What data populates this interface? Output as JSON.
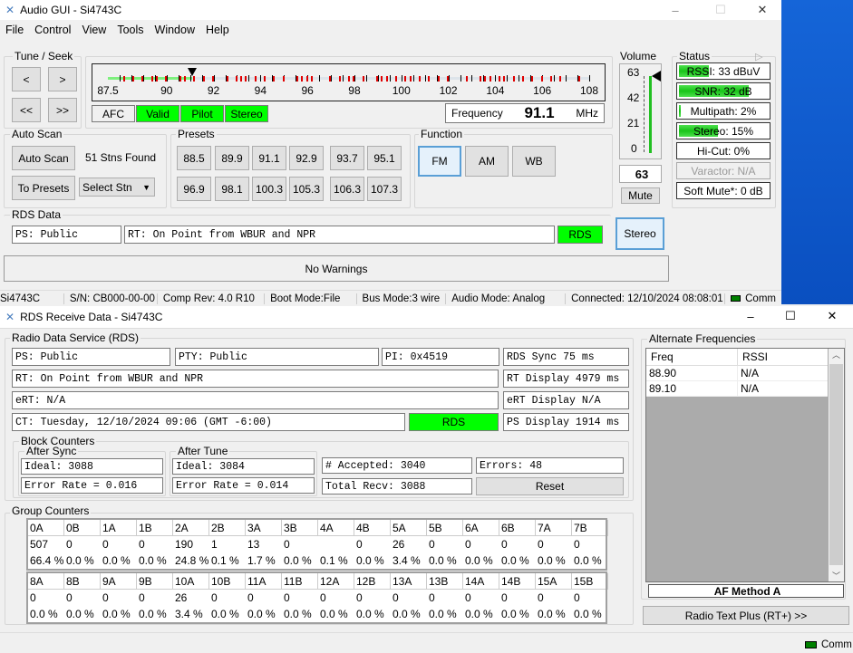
{
  "main_window": {
    "title": "Audio GUI - Si4743C",
    "menu": [
      "File",
      "Control",
      "View",
      "Tools",
      "Window",
      "Help"
    ],
    "tune_seek": {
      "label": "Tune / Seek",
      "buttons": [
        "<",
        ">",
        "<<",
        ">>"
      ]
    },
    "scale": {
      "ticks": [
        "87.5",
        "90",
        "92",
        "94",
        "96",
        "98",
        "100",
        "102",
        "104",
        "106",
        "108"
      ],
      "min": 87.5,
      "max": 108,
      "current": 91.1
    },
    "indicators": [
      {
        "label": "AFC",
        "on": false
      },
      {
        "label": "Valid",
        "on": true
      },
      {
        "label": "Pilot",
        "on": true
      },
      {
        "label": "Stereo",
        "on": true
      }
    ],
    "frequency": {
      "label": "Frequency",
      "value": "91.1",
      "unit": "MHz"
    },
    "auto_scan": {
      "label": "Auto Scan",
      "button": "Auto Scan",
      "found": "51 Stns Found",
      "to_presets": "To Presets",
      "select": "Select Stn"
    },
    "presets": {
      "label": "Presets",
      "values": [
        "88.5",
        "89.9",
        "91.1",
        "92.9",
        "93.7",
        "95.1",
        "96.9",
        "98.1",
        "100.3",
        "105.3",
        "106.3",
        "107.3"
      ]
    },
    "function": {
      "label": "Function",
      "options": [
        "FM",
        "AM",
        "WB"
      ],
      "selected": "FM"
    },
    "volume": {
      "label": "Volume",
      "ticks": [
        "63",
        "42",
        "21",
        "0"
      ],
      "value": "63",
      "max": 63,
      "mute": "Mute"
    },
    "status": {
      "label": "Status",
      "items": [
        {
          "text": "RSSI: 33 dBuV",
          "level": 0.33
        },
        {
          "text": "SNR: 32 dB",
          "level": 0.77
        },
        {
          "text": "Multipath: 2%",
          "level": 0.02
        },
        {
          "text": "Stereo: 15%",
          "level": 0.43
        },
        {
          "text": "Hi-Cut: 0%",
          "level": 0
        },
        {
          "text": "Varactor: N/A",
          "level": 0,
          "disabled": true
        },
        {
          "text": "Soft Mute*: 0 dB",
          "level": 0
        }
      ]
    },
    "rds": {
      "label": "RDS Data",
      "ps": "PS:  Public",
      "rt": "RT: On Point from WBUR and NPR",
      "rds_button": "RDS",
      "stereo_button": "Stereo"
    },
    "warnings": "No Warnings",
    "statusbar": [
      "Si4743C",
      "S/N: CB000-00-00",
      "Comp Rev: 4.0 R10",
      "Boot Mode:File",
      "Bus Mode:3 wire",
      "Audio Mode: Analog",
      "Connected: 12/10/2024 08:08:01",
      "Comm"
    ],
    "colors": {
      "on": "#00ff00",
      "comm": "#008000"
    }
  },
  "rds_window": {
    "title": "RDS Receive Data - Si4743C",
    "rds_group": "Radio Data Service (RDS)",
    "ps": "PS:  Public",
    "pty": "PTY: Public",
    "pi": "PI: 0x4519",
    "rds_sync": "RDS Sync 75 ms",
    "rt": "RT: On Point from WBUR and NPR",
    "rt_display": "RT Display 4979 ms",
    "ert": "eRT: N/A",
    "ert_display": "eRT Display N/A",
    "ct": "CT: Tuesday, 12/10/2024 09:06 (GMT -6:00)",
    "rds_indicator": "RDS",
    "ps_display": "PS Display 1914 ms",
    "block_counters": {
      "label": "Block Counters",
      "after_sync": {
        "label": "After Sync",
        "ideal": "Ideal: 3088",
        "error_rate": "Error Rate = 0.016"
      },
      "after_tune": {
        "label": "After Tune",
        "ideal": "Ideal: 3084",
        "error_rate": "Error Rate = 0.014"
      },
      "accepted": "# Accepted: 3040",
      "errors": "Errors: 48",
      "total": "Total Recv: 3088",
      "reset": "Reset"
    },
    "group_counters": {
      "label": "Group Counters",
      "tables": [
        {
          "headers": [
            "0A",
            "0B",
            "1A",
            "1B",
            "2A",
            "2B",
            "3A",
            "3B",
            "4A",
            "4B",
            "5A",
            "5B",
            "6A",
            "6B",
            "7A",
            "7B"
          ],
          "counts": [
            "507",
            "0",
            "0",
            "0",
            "190",
            "1",
            "13",
            "0",
            "",
            "0",
            "26",
            "0",
            "0",
            "0",
            "0",
            "0"
          ],
          "percents": [
            "66.4 %",
            "0.0 %",
            "0.0 %",
            "0.0 %",
            "24.8 %",
            "0.1 %",
            "1.7 %",
            "0.0 %",
            "0.1 %",
            "0.0 %",
            "3.4 %",
            "0.0 %",
            "0.0 %",
            "0.0 %",
            "0.0 %",
            "0.0 %"
          ]
        },
        {
          "headers": [
            "8A",
            "8B",
            "9A",
            "9B",
            "10A",
            "10B",
            "11A",
            "11B",
            "12A",
            "12B",
            "13A",
            "13B",
            "14A",
            "14B",
            "15A",
            "15B"
          ],
          "counts": [
            "0",
            "0",
            "0",
            "0",
            "26",
            "0",
            "0",
            "0",
            "0",
            "0",
            "0",
            "0",
            "0",
            "0",
            "0",
            "0"
          ],
          "percents": [
            "0.0 %",
            "0.0 %",
            "0.0 %",
            "0.0 %",
            "3.4 %",
            "0.0 %",
            "0.0 %",
            "0.0 %",
            "0.0 %",
            "0.0 %",
            "0.0 %",
            "0.0 %",
            "0.0 %",
            "0.0 %",
            "0.0 %",
            "0.0 %"
          ]
        }
      ]
    },
    "alt_freq": {
      "label": "Alternate Frequencies",
      "columns": [
        "Freq",
        "RSSI"
      ],
      "rows": [
        [
          "88.90",
          "N/A"
        ],
        [
          "89.10",
          "N/A"
        ]
      ],
      "method": "AF Method A"
    },
    "rt_plus": "Radio Text Plus (RT+)  >>",
    "comm": "Comm"
  }
}
